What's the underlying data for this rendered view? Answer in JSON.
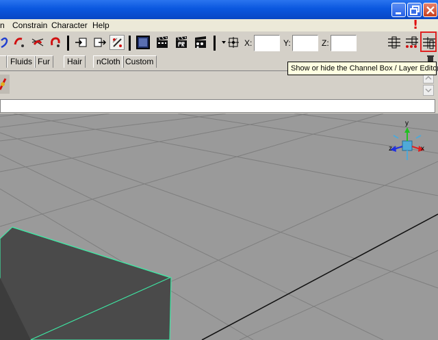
{
  "window": {
    "controls": {
      "minimize": "minimize-icon",
      "maximize": "maximize-icon",
      "close": "close-icon"
    }
  },
  "menubar": {
    "items": [
      {
        "label": "n"
      },
      {
        "label": "Constrain"
      },
      {
        "label": "Character"
      },
      {
        "label": "Help"
      }
    ]
  },
  "toolbar": {
    "coords": {
      "x_label": "X:",
      "y_label": "Y:",
      "z_label": "Z:",
      "x_value": "",
      "y_value": "",
      "z_value": ""
    },
    "icons": [
      "select-by-hierarchy-icon",
      "snap-to-curve-icon",
      "snap-to-point-icon",
      "snap-to-surface-icon",
      "input-history-icon",
      "output-history-icon",
      "construction-history-icon",
      "render-view-icon",
      "render-current-frame-icon",
      "ipr-render-icon",
      "render-settings-icon",
      "transform-input-icon",
      "attribute-editor-icon",
      "tool-settings-icon",
      "channel-box-toggle-icon"
    ],
    "alert": "!"
  },
  "shelf": {
    "tabs": [
      {
        "label": ""
      },
      {
        "label": "Fluids"
      },
      {
        "label": "Fur"
      },
      {
        "label": "Hair"
      },
      {
        "label": "nCloth"
      },
      {
        "label": "Custom"
      }
    ],
    "tooltip": "Show or hide the Channel Box / Layer Editor"
  },
  "viewport": {
    "axis_labels": {
      "x": "x",
      "y": "y",
      "z": "z"
    },
    "colors": {
      "background": "#9a9a9a",
      "grid": "#7e7e7e",
      "cube_face": "#4a4a4a",
      "cube_edge": "#3ee8a4",
      "axis_x": "#e02020",
      "axis_y": "#20c020",
      "axis_z": "#2030e0",
      "view_cube": "#4fa9d8"
    }
  },
  "colors": {
    "accent": "#0a57df",
    "highlight": "#e02020",
    "tooltip_bg": "#ffffe1"
  }
}
